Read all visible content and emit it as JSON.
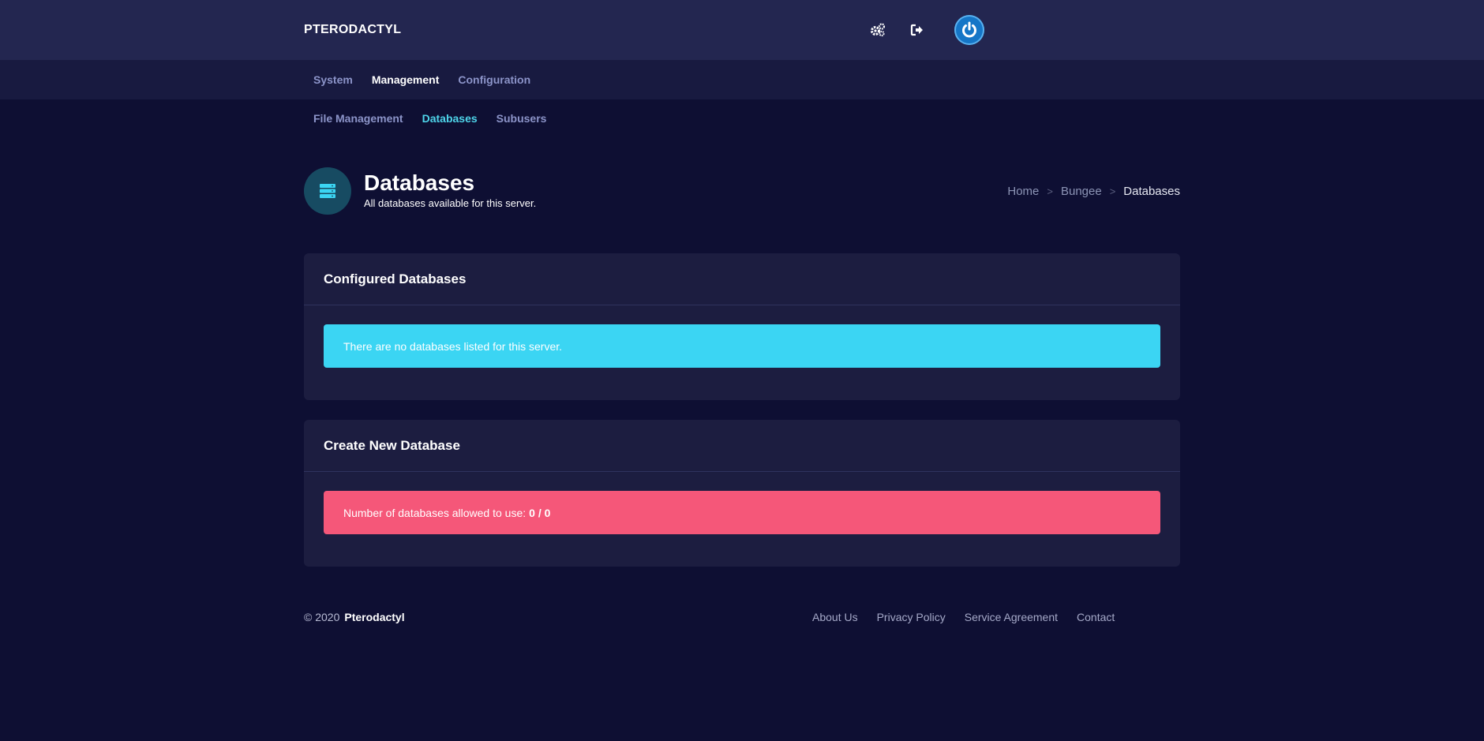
{
  "topbar": {
    "brand": "PTERODACTYL",
    "icons": [
      "cogs-icon",
      "sign-out-icon",
      "power-icon"
    ]
  },
  "nav": {
    "primary": [
      {
        "label": "System",
        "active": false
      },
      {
        "label": "Management",
        "active": true
      },
      {
        "label": "Configuration",
        "active": false
      }
    ],
    "secondary": [
      {
        "label": "File Management",
        "active": false
      },
      {
        "label": "Databases",
        "active": true
      },
      {
        "label": "Subusers",
        "active": false
      }
    ]
  },
  "header": {
    "icon": "database-icon",
    "title": "Databases",
    "subtitle": "All databases available for this server."
  },
  "breadcrumb": [
    "Home",
    "Bungee",
    "Databases"
  ],
  "configured": {
    "title": "Configured Databases",
    "message": "There are no databases listed for this server."
  },
  "create": {
    "title": "Create New Database",
    "message_prefix": "Number of databases allowed to use:",
    "usage": "0 / 0"
  },
  "footer": {
    "copyright": "© 2020",
    "brand": "Pterodactyl",
    "links": [
      "About Us",
      "Privacy Policy",
      "Service Agreement",
      "Contact"
    ]
  },
  "colors": {
    "background": "#0e0f33",
    "topbar": "#232650",
    "card": "#1c1d40",
    "info": "#3bd5f3",
    "danger": "#f55779",
    "accent": "#4ed5ea"
  }
}
